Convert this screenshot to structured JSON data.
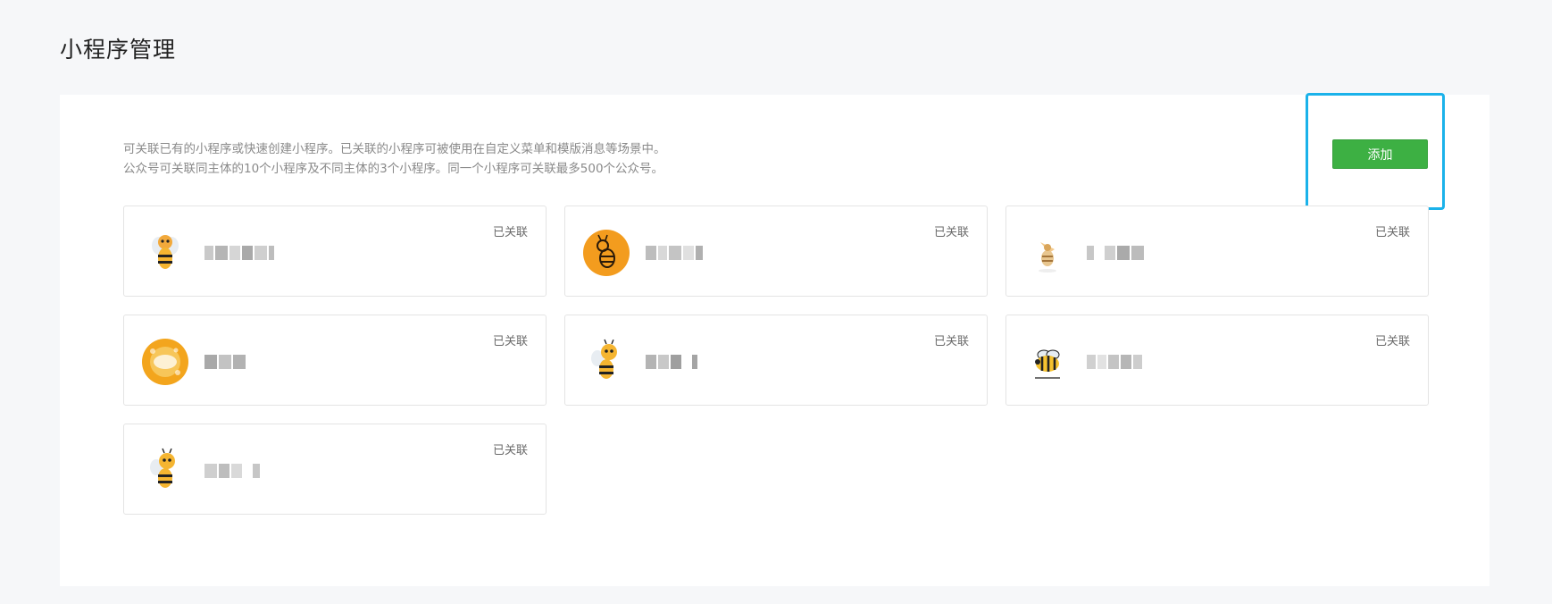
{
  "header": {
    "title": "小程序管理"
  },
  "intro": {
    "line1": "可关联已有的小程序或快速创建小程序。已关联的小程序可被使用在自定义菜单和模版消息等场景中。",
    "line2": "公众号可关联同主体的10个小程序及不同主体的3个小程序。同一个小程序可关联最多500个公众号。"
  },
  "actions": {
    "add_label": "添加"
  },
  "cards": [
    {
      "status": "已关联",
      "avatar_icon": "bee-mascot-icon"
    },
    {
      "status": "已关联",
      "avatar_icon": "bee-orange-circle-icon"
    },
    {
      "status": "已关联",
      "avatar_icon": "bee-sketch-icon"
    },
    {
      "status": "已关联",
      "avatar_icon": "honeycomb-badge-icon"
    },
    {
      "status": "已关联",
      "avatar_icon": "bee-mascot-icon"
    },
    {
      "status": "已关联",
      "avatar_icon": "bee-flying-icon"
    },
    {
      "status": "已关联",
      "avatar_icon": "bee-mascot-icon"
    }
  ],
  "colors": {
    "accent_green": "#3db043",
    "highlight_blue": "#1bb2ea",
    "honey_orange": "#f39c1e"
  }
}
